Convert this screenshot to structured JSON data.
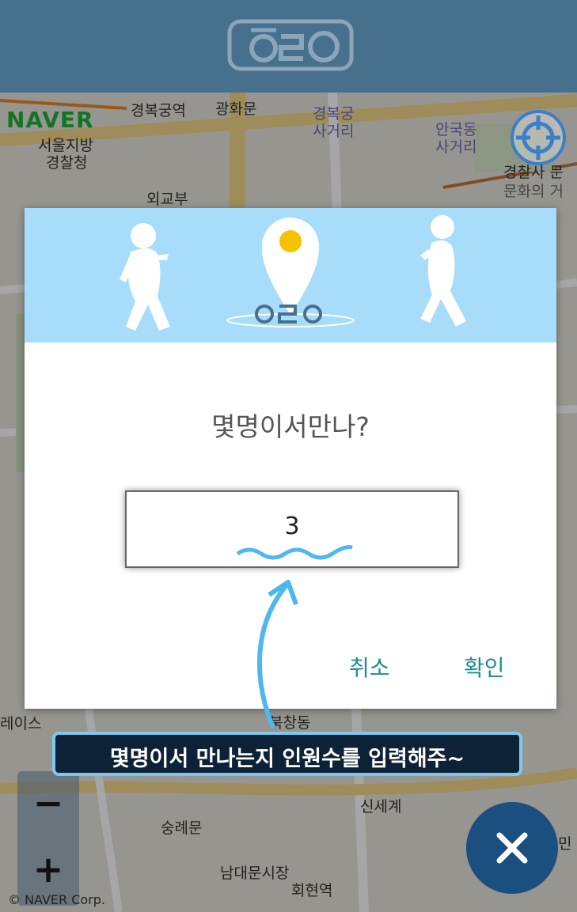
{
  "header": {
    "logo_text": "O2O"
  },
  "map": {
    "provider": "NAVER",
    "copyright": "© NAVER Corp.",
    "labels": [
      "경복궁역",
      "광화문",
      "경복궁",
      "사거리",
      "안국동",
      "사거리",
      "서울지방",
      "경찰청",
      "외교부",
      "문화의 거",
      "경찰사 문",
      "신세계",
      "숭례문",
      "남대문시장",
      "회현역",
      "북창동",
      "레이스",
      "민"
    ]
  },
  "dialog": {
    "banner_logo_text": "O2O",
    "title": "몇명이서만나?",
    "input_value": "3",
    "cancel_label": "취소",
    "ok_label": "확인"
  },
  "hint": {
    "text": "몇명이서 만나는지 인원수를 입력해주~"
  },
  "controls": {
    "zoom_out_label": "−",
    "zoom_in_label": "+",
    "close_icon": "close-icon",
    "locate_icon": "crosshair-icon"
  },
  "colors": {
    "header": "#46708c",
    "banner": "#a8dcfb",
    "accent_text": "#1a8f8a",
    "pin_dot": "#f5c400",
    "hint_border": "#7ec8f0",
    "fab": "#1b4f80"
  }
}
